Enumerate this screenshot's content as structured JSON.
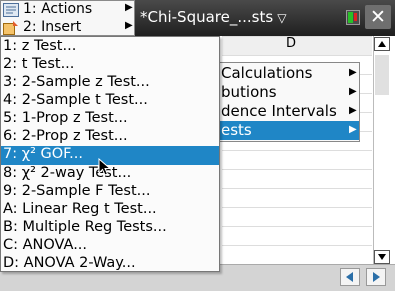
{
  "app": {
    "document_tab": "*Chi-Square_...sts"
  },
  "top_menu": {
    "items": [
      {
        "label": "1: Actions"
      },
      {
        "label": "2: Insert"
      }
    ]
  },
  "sheet": {
    "column_label": "D"
  },
  "stats_submenu": {
    "items": [
      {
        "label": "Calculations"
      },
      {
        "label": "butions"
      },
      {
        "label": "dence Intervals"
      },
      {
        "label": "ests"
      }
    ],
    "selected_index": 3
  },
  "test_menu": {
    "items": [
      {
        "label": "1: z Test..."
      },
      {
        "label": "2: t Test..."
      },
      {
        "label": "3: 2-Sample z Test..."
      },
      {
        "label": "4: 2-Sample t Test..."
      },
      {
        "label": "5: 1-Prop z Test..."
      },
      {
        "label": "6: 2-Prop z Test..."
      },
      {
        "label": "7: χ² GOF..."
      },
      {
        "label": "8: χ² 2-way Test..."
      },
      {
        "label": "9: 2-Sample F Test..."
      },
      {
        "label": "A: Linear Reg t Test..."
      },
      {
        "label": "B: Multiple Reg Tests..."
      },
      {
        "label": "C: ANOVA..."
      },
      {
        "label": "D: ANOVA 2-Way..."
      }
    ],
    "selected_index": 6
  },
  "icons": {
    "close": "close-icon",
    "battery": "battery-icon",
    "cursor": "mouse-pointer-icon"
  },
  "colors": {
    "selection": "#1f86c6",
    "titlebar": "#2d2d2d",
    "nav_arrows": "#2b6fa8"
  }
}
